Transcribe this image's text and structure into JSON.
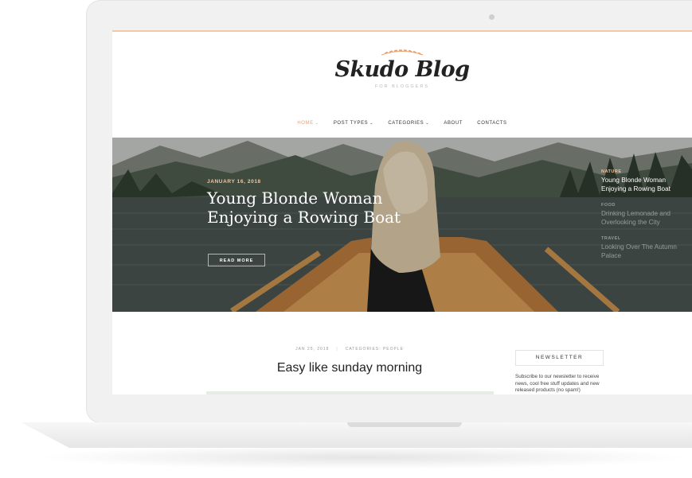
{
  "logo": {
    "title": "Skudo Blog",
    "tagline": "FOR BLOGGERS"
  },
  "nav": {
    "items": [
      {
        "label": "HOME",
        "caret": "⌄",
        "active": true
      },
      {
        "label": "POST TYPES",
        "caret": "⌄"
      },
      {
        "label": "CATEGORIES",
        "caret": "⌄"
      },
      {
        "label": "ABOUT"
      },
      {
        "label": "CONTACTS"
      }
    ]
  },
  "hero": {
    "date": "JANUARY 16, 2018",
    "title_line1": "Young Blonde Woman",
    "title_line2": "Enjoying a Rowing Boat",
    "read_more": "READ MORE",
    "side_posts": [
      {
        "category": "NATURE",
        "title": "Young Blonde Woman Enjoying a Rowing Boat"
      },
      {
        "category": "FOOD",
        "title": "Drinking Lemonade and Overlooking the City"
      },
      {
        "category": "TRAVEL",
        "title": "Looking Over The Autumn Palace"
      }
    ]
  },
  "post": {
    "date": "JAN 25, 2018",
    "separator": "|",
    "categories": "CATEGORIES: PEOPLE",
    "title": "Easy like sunday morning"
  },
  "newsletter": {
    "heading": "NEWSLETTER",
    "text": "Subscribe to our newsletter to receive news, cool free stuff updates and new released products (no spam!)"
  },
  "colors": {
    "accent": "#e9a273",
    "hero_date": "#f2c79f"
  }
}
